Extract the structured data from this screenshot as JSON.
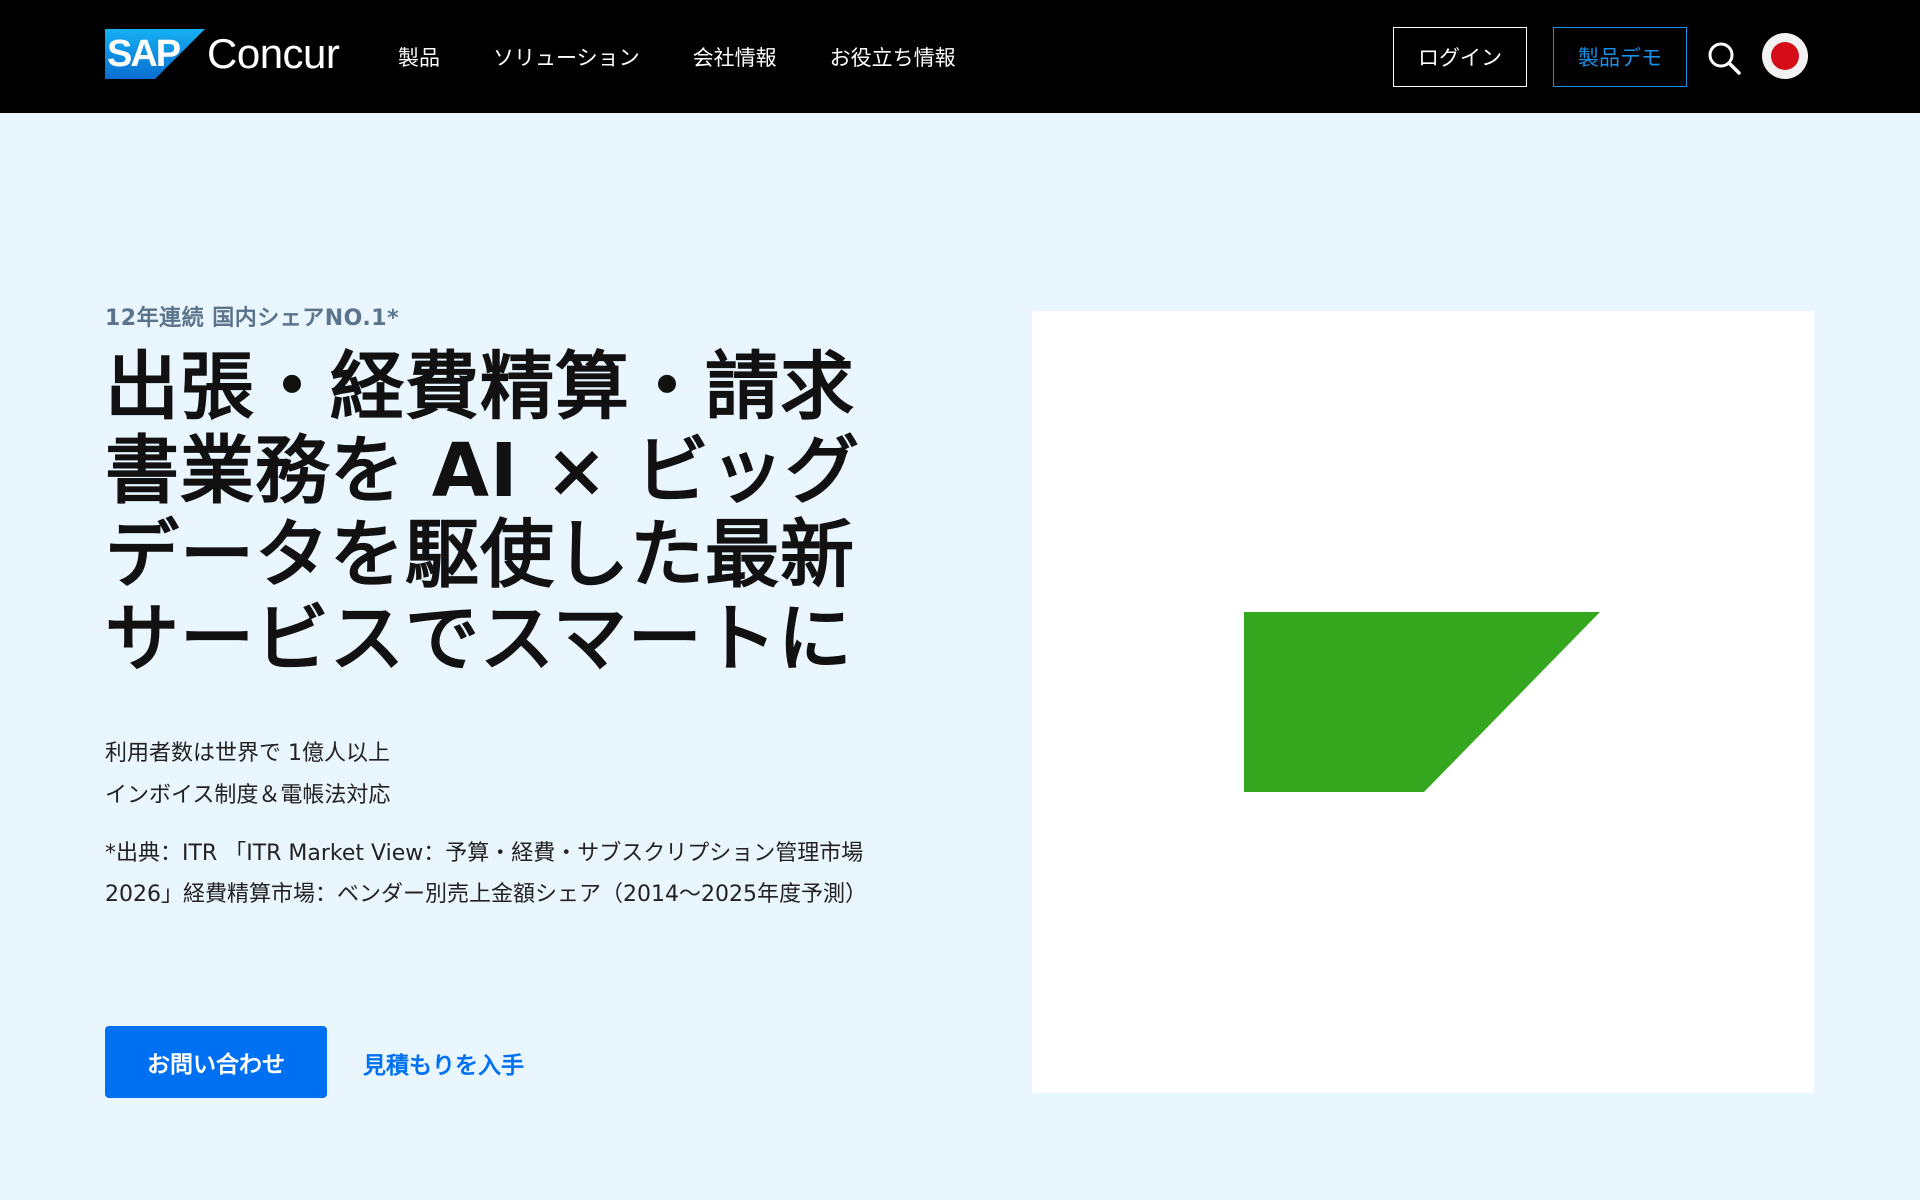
{
  "header": {
    "logo": {
      "badge": "SAP",
      "name": "Concur"
    },
    "nav": [
      "製品",
      "ソリューション",
      "会社情報",
      "お役立ち情報"
    ],
    "login_label": "ログイン",
    "demo_label": "製品デモ",
    "icons": {
      "search": "search-icon",
      "region": "japan-flag-icon"
    }
  },
  "hero": {
    "eyebrow": "12年連続 国内シェアNO.1*",
    "headline": "出張・経費精算・請求書業務を AI × ビッグデータを駆使した最新サービスでスマートに",
    "sub_line1": "利用者数は世界で 1億人以上",
    "sub_line2": "インボイス制度＆電帳法対応",
    "source": "*出典：ITR 「ITR Market View：予算・経費・サブスクリプション管理市場2026」経費精算市場：ベンダー別売上金額シェア（2014〜2025年度予測）",
    "contact_label": "お問い合わせ",
    "quote_label": "見積もりを入手"
  },
  "colors": {
    "header_bg": "#000000",
    "page_bg": "#e9f6fe",
    "primary": "#0070f2",
    "demo_outline": "#1a8fe3",
    "shape_green": "#35a71f",
    "flag_red": "#d70c19"
  }
}
